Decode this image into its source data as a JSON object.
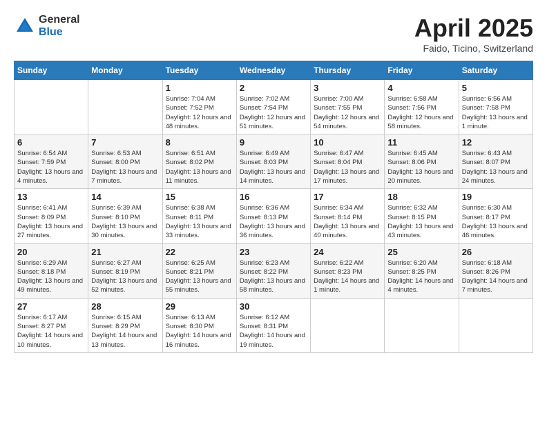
{
  "header": {
    "logo_general": "General",
    "logo_blue": "Blue",
    "title": "April 2025",
    "location": "Faido, Ticino, Switzerland"
  },
  "weekdays": [
    "Sunday",
    "Monday",
    "Tuesday",
    "Wednesday",
    "Thursday",
    "Friday",
    "Saturday"
  ],
  "weeks": [
    [
      {
        "day": "",
        "info": ""
      },
      {
        "day": "",
        "info": ""
      },
      {
        "day": "1",
        "info": "Sunrise: 7:04 AM\nSunset: 7:52 PM\nDaylight: 12 hours and 48 minutes."
      },
      {
        "day": "2",
        "info": "Sunrise: 7:02 AM\nSunset: 7:54 PM\nDaylight: 12 hours and 51 minutes."
      },
      {
        "day": "3",
        "info": "Sunrise: 7:00 AM\nSunset: 7:55 PM\nDaylight: 12 hours and 54 minutes."
      },
      {
        "day": "4",
        "info": "Sunrise: 6:58 AM\nSunset: 7:56 PM\nDaylight: 12 hours and 58 minutes."
      },
      {
        "day": "5",
        "info": "Sunrise: 6:56 AM\nSunset: 7:58 PM\nDaylight: 13 hours and 1 minute."
      }
    ],
    [
      {
        "day": "6",
        "info": "Sunrise: 6:54 AM\nSunset: 7:59 PM\nDaylight: 13 hours and 4 minutes."
      },
      {
        "day": "7",
        "info": "Sunrise: 6:53 AM\nSunset: 8:00 PM\nDaylight: 13 hours and 7 minutes."
      },
      {
        "day": "8",
        "info": "Sunrise: 6:51 AM\nSunset: 8:02 PM\nDaylight: 13 hours and 11 minutes."
      },
      {
        "day": "9",
        "info": "Sunrise: 6:49 AM\nSunset: 8:03 PM\nDaylight: 13 hours and 14 minutes."
      },
      {
        "day": "10",
        "info": "Sunrise: 6:47 AM\nSunset: 8:04 PM\nDaylight: 13 hours and 17 minutes."
      },
      {
        "day": "11",
        "info": "Sunrise: 6:45 AM\nSunset: 8:06 PM\nDaylight: 13 hours and 20 minutes."
      },
      {
        "day": "12",
        "info": "Sunrise: 6:43 AM\nSunset: 8:07 PM\nDaylight: 13 hours and 24 minutes."
      }
    ],
    [
      {
        "day": "13",
        "info": "Sunrise: 6:41 AM\nSunset: 8:09 PM\nDaylight: 13 hours and 27 minutes."
      },
      {
        "day": "14",
        "info": "Sunrise: 6:39 AM\nSunset: 8:10 PM\nDaylight: 13 hours and 30 minutes."
      },
      {
        "day": "15",
        "info": "Sunrise: 6:38 AM\nSunset: 8:11 PM\nDaylight: 13 hours and 33 minutes."
      },
      {
        "day": "16",
        "info": "Sunrise: 6:36 AM\nSunset: 8:13 PM\nDaylight: 13 hours and 36 minutes."
      },
      {
        "day": "17",
        "info": "Sunrise: 6:34 AM\nSunset: 8:14 PM\nDaylight: 13 hours and 40 minutes."
      },
      {
        "day": "18",
        "info": "Sunrise: 6:32 AM\nSunset: 8:15 PM\nDaylight: 13 hours and 43 minutes."
      },
      {
        "day": "19",
        "info": "Sunrise: 6:30 AM\nSunset: 8:17 PM\nDaylight: 13 hours and 46 minutes."
      }
    ],
    [
      {
        "day": "20",
        "info": "Sunrise: 6:29 AM\nSunset: 8:18 PM\nDaylight: 13 hours and 49 minutes."
      },
      {
        "day": "21",
        "info": "Sunrise: 6:27 AM\nSunset: 8:19 PM\nDaylight: 13 hours and 52 minutes."
      },
      {
        "day": "22",
        "info": "Sunrise: 6:25 AM\nSunset: 8:21 PM\nDaylight: 13 hours and 55 minutes."
      },
      {
        "day": "23",
        "info": "Sunrise: 6:23 AM\nSunset: 8:22 PM\nDaylight: 13 hours and 58 minutes."
      },
      {
        "day": "24",
        "info": "Sunrise: 6:22 AM\nSunset: 8:23 PM\nDaylight: 14 hours and 1 minute."
      },
      {
        "day": "25",
        "info": "Sunrise: 6:20 AM\nSunset: 8:25 PM\nDaylight: 14 hours and 4 minutes."
      },
      {
        "day": "26",
        "info": "Sunrise: 6:18 AM\nSunset: 8:26 PM\nDaylight: 14 hours and 7 minutes."
      }
    ],
    [
      {
        "day": "27",
        "info": "Sunrise: 6:17 AM\nSunset: 8:27 PM\nDaylight: 14 hours and 10 minutes."
      },
      {
        "day": "28",
        "info": "Sunrise: 6:15 AM\nSunset: 8:29 PM\nDaylight: 14 hours and 13 minutes."
      },
      {
        "day": "29",
        "info": "Sunrise: 6:13 AM\nSunset: 8:30 PM\nDaylight: 14 hours and 16 minutes."
      },
      {
        "day": "30",
        "info": "Sunrise: 6:12 AM\nSunset: 8:31 PM\nDaylight: 14 hours and 19 minutes."
      },
      {
        "day": "",
        "info": ""
      },
      {
        "day": "",
        "info": ""
      },
      {
        "day": "",
        "info": ""
      }
    ]
  ]
}
